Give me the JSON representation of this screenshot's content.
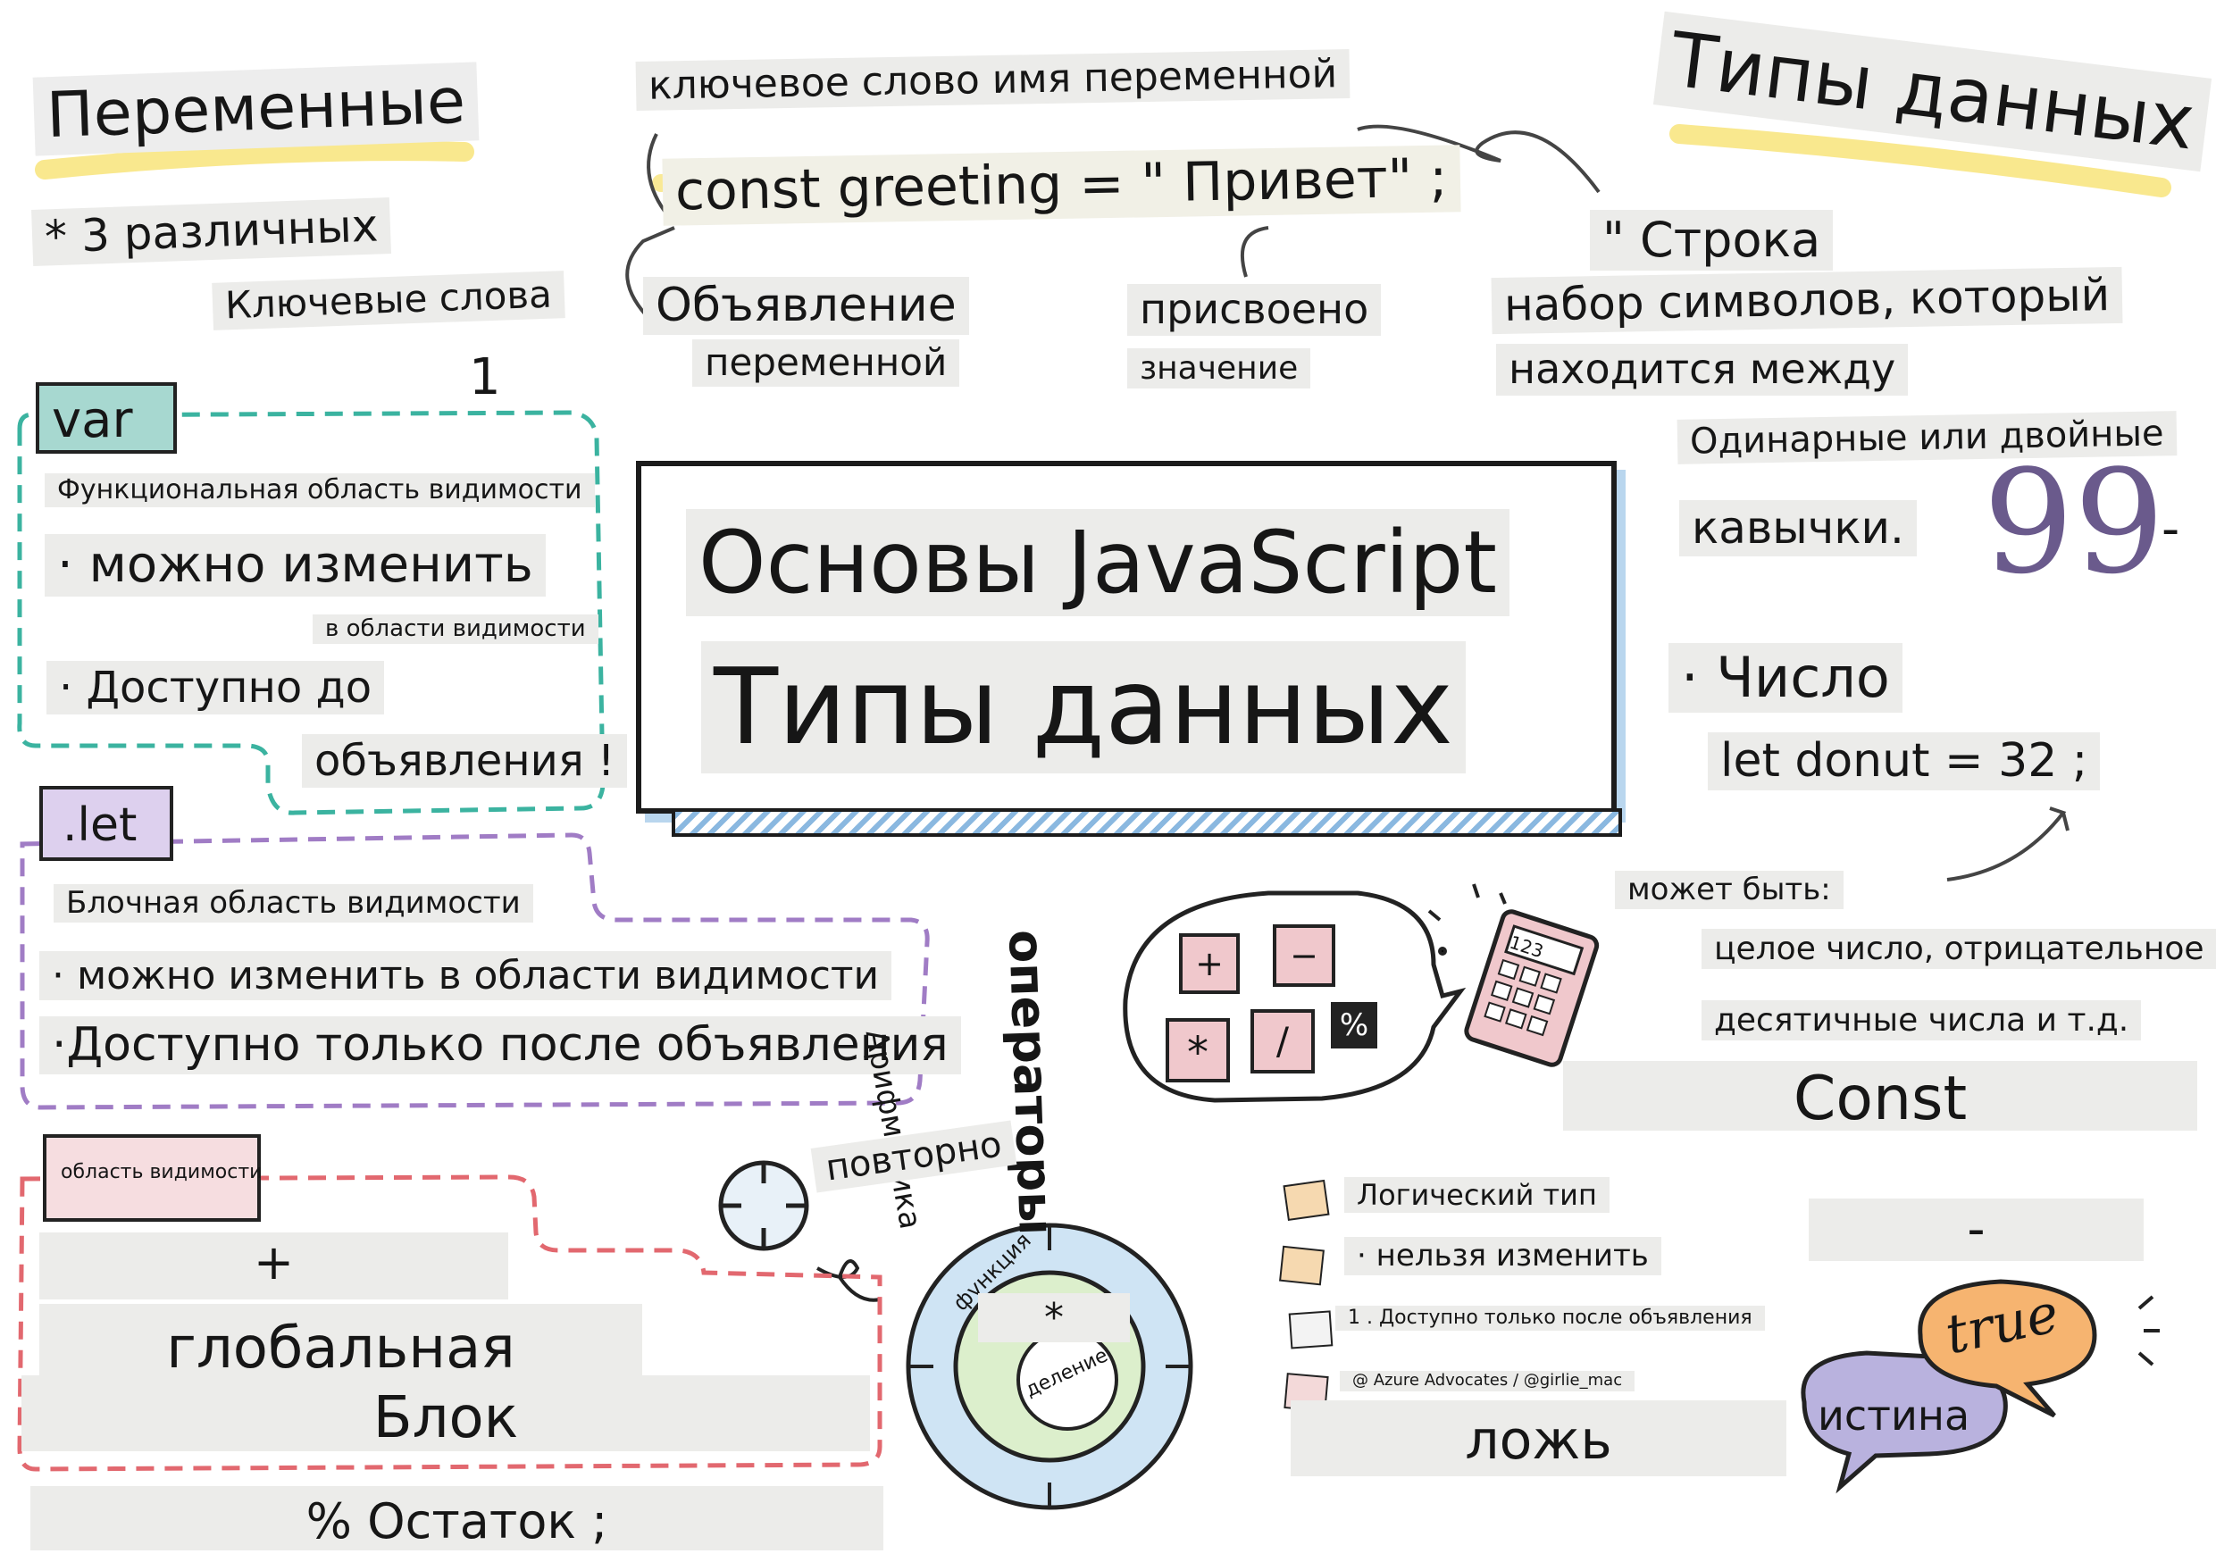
{
  "variables": {
    "title": "Переменные",
    "three_different": "* 3 различных",
    "keywords": "Ключевые слова",
    "number_one": "1"
  },
  "declaration": {
    "keyword_and_name": "ключевое слово имя переменной",
    "code": "const greeting = \" Привет\" ;",
    "declaration_line1": "Объявление",
    "declaration_line2": "переменной",
    "assigned_line1": "присвоено",
    "assigned_line2": "значение"
  },
  "data_types_header": "Типы данных",
  "string": {
    "title": "\" Строка",
    "line1": "набор символов, который",
    "line2": "находится между",
    "line3": "Одинарные или двойные",
    "line4": "кавычки.",
    "quote_glyph": "99",
    "dash": "-"
  },
  "center": {
    "title": "Основы JavaScript",
    "subtitle": "Типы данных"
  },
  "var_block": {
    "tag": "var",
    "scope": "Функциональная область видимости",
    "can_change": "· можно изменить",
    "in_scope": "в области видимости",
    "available_line1": "· Доступно до",
    "available_line2": "объявления !"
  },
  "let_block": {
    "tag": ".let",
    "scope": "Блочная область видимости",
    "can_change": "· можно изменить в области видимости",
    "available_after": "·Доступно только после объявления"
  },
  "scope_block": {
    "tag": "область видимости",
    "plus": "+",
    "global": "глобальная",
    "block": "Блок",
    "remainder": "% Остаток ;"
  },
  "operators": {
    "arithmetic": "Арифметика",
    "operators": "операторы",
    "plus_key": "+",
    "minus_key": "−",
    "mult_key": "*",
    "div_key": "/",
    "percent_key": "%",
    "calc_display": "123"
  },
  "repeat": {
    "label": "повторно",
    "function_label": "функция",
    "star": "*",
    "division": "деление"
  },
  "number": {
    "title": "· Число",
    "code": "let donut = 32 ;",
    "can_be": "может быть:",
    "line1": "целое число, отрицательное",
    "line2": "десятичные числа и т.д."
  },
  "const": {
    "title": "Const",
    "dash": "-",
    "boolean": "Логический тип",
    "cannot_change": "· нельзя изменить",
    "available_after": "1 . Доступно только после объявления",
    "credit": "@ Azure Advocates / @girlie_mac",
    "false_label": "ложь",
    "true_label": "true",
    "truth_label": "истина"
  },
  "colors": {
    "var_dash": "#3bb3a0",
    "let_dash": "#a07cc5",
    "scope_dash": "#e2686f",
    "var_tag": "#a7d8d0",
    "let_tag": "#ddd0ee",
    "scope_tag": "#f6dde0",
    "highlight_yellow": "#f8e47a",
    "true_bubble": "#f6b470",
    "truth_bubble": "#b9b2de",
    "key_pink": "#f0c8cc",
    "ring_blue": "#cfe4f4",
    "ring_green": "#dcefcc"
  }
}
